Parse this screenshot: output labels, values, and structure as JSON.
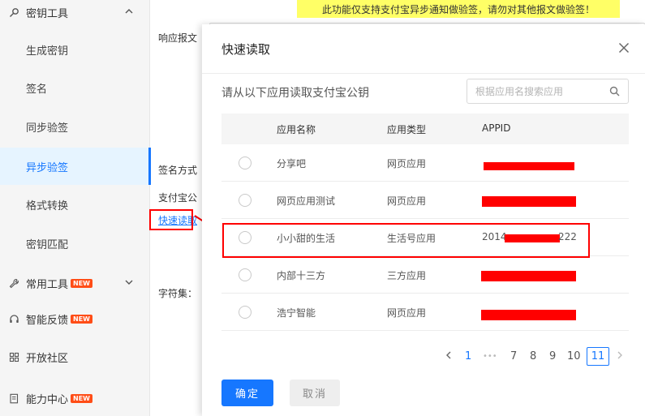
{
  "sidebar": {
    "top_group": {
      "label": "密钥工具",
      "icon": "key-icon"
    },
    "items": [
      {
        "label": "生成密钥",
        "active": false
      },
      {
        "label": "签名",
        "active": false
      },
      {
        "label": "同步验签",
        "active": false
      },
      {
        "label": "异步验签",
        "active": true
      },
      {
        "label": "格式转换",
        "active": false
      },
      {
        "label": "密钥匹配",
        "active": false
      }
    ],
    "groups": [
      {
        "label": "常用工具",
        "icon": "wrench-icon",
        "badge": "NEW",
        "chevron": true
      },
      {
        "label": "智能反馈",
        "icon": "headset-icon",
        "badge": "NEW",
        "chevron": false
      },
      {
        "label": "开放社区",
        "icon": "grid-icon",
        "badge": "",
        "chevron": false
      },
      {
        "label": "能力中心",
        "icon": "doc-icon",
        "badge": "NEW",
        "chevron": false
      }
    ]
  },
  "main": {
    "notice": "此功能仅支持支付宝异步通知做验签，请勿对其他报文做验签！",
    "response_label": "响应报文",
    "sign_method_label": "签名方式",
    "alipay_pubkey_label": "支付宝公",
    "quick_read_link": "快速读取",
    "charset_label": "字符集："
  },
  "drawer": {
    "title": "快速读取",
    "description": "请从以下应用读取支付宝公钥",
    "search_placeholder": "根据应用名搜索应用",
    "columns": {
      "name": "应用名称",
      "type": "应用类型",
      "appid": "APPID"
    },
    "rows": [
      {
        "name": "分享吧",
        "type": "网页应用",
        "appid_prefix": "",
        "appid_suffix": ""
      },
      {
        "name": "网页应用测试",
        "type": "网页应用",
        "appid_prefix": "",
        "appid_suffix": ""
      },
      {
        "name": "小小甜的生活",
        "type": "生活号应用",
        "appid_prefix": "2014",
        "appid_suffix": "222"
      },
      {
        "name": "内部十三方",
        "type": "三方应用",
        "appid_prefix": "",
        "appid_suffix": ""
      },
      {
        "name": "浩宁智能",
        "type": "网页应用",
        "appid_prefix": "",
        "appid_suffix": ""
      }
    ],
    "pagination": {
      "first": "1",
      "ellipsis": "•••",
      "pages": [
        "7",
        "8",
        "9",
        "10"
      ],
      "current": "11"
    },
    "confirm_label": "确定",
    "cancel_label": "取消"
  },
  "colors": {
    "accent": "#1677ff",
    "badge": "#ff4d17",
    "annotation_red": "#ff0000",
    "notice_bg": "#ffff66"
  }
}
